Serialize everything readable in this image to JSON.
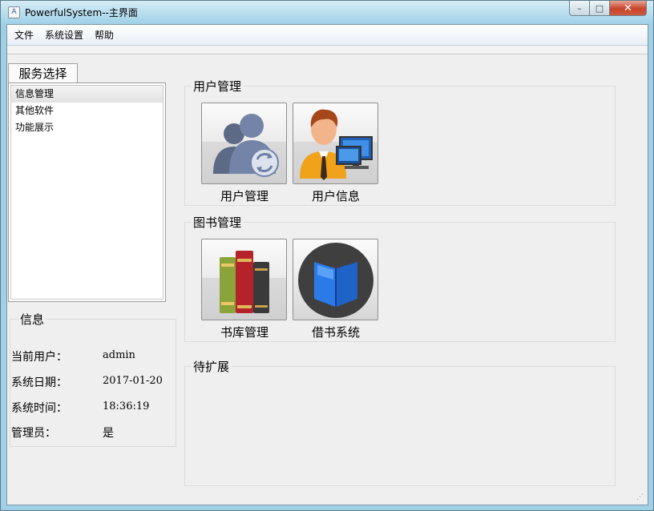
{
  "window": {
    "title": "PowerfulSystem--主界面",
    "app_icon_glyph": "A",
    "controls": {
      "minimize": "–",
      "maximize": "□",
      "close": "✕"
    }
  },
  "menubar": {
    "items": [
      "文件",
      "系统设置",
      "帮助"
    ]
  },
  "sidebar": {
    "tab_label": "服务选择",
    "items": [
      "信息管理",
      "其他软件",
      "功能展示"
    ],
    "selected_index": 0
  },
  "info": {
    "title": "信息",
    "rows": [
      {
        "label": "当前用户：",
        "value": "admin"
      },
      {
        "label": "系统日期：",
        "value": "2017-01-20"
      },
      {
        "label": "系统时间：",
        "value": "18:36:19"
      },
      {
        "label": "管理员：",
        "value": "是"
      }
    ]
  },
  "groups": {
    "user": {
      "title": "用户管理",
      "tiles": [
        {
          "label": "用户管理",
          "icon": "user-group-refresh-icon"
        },
        {
          "label": "用户信息",
          "icon": "user-computer-icon"
        }
      ]
    },
    "book": {
      "title": "图书管理",
      "tiles": [
        {
          "label": "书库管理",
          "icon": "book-stack-icon"
        },
        {
          "label": "借书系统",
          "icon": "open-book-icon"
        }
      ]
    },
    "ext": {
      "title": "待扩展"
    }
  },
  "colors": {
    "titlebar": "#a9d6ea",
    "close_button": "#c7442c",
    "panel_background": "#efefef"
  }
}
